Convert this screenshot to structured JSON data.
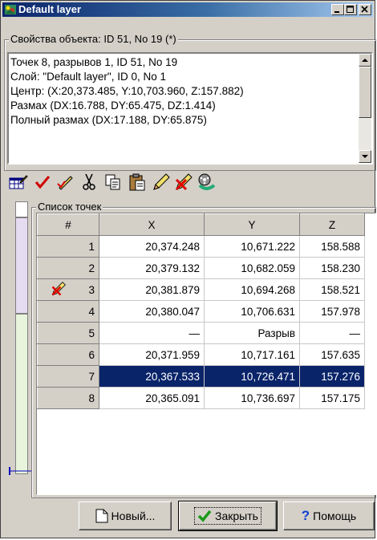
{
  "window": {
    "title": "Default layer",
    "controls": [
      "minimize-icon",
      "maximize-icon",
      "close-icon"
    ]
  },
  "properties": {
    "legend": "Свойства объекта: ID 51, No 19 (*)",
    "lines": [
      "Точек 8, разрывов 1, ID 51, No 19",
      "Слой: \"Default layer\", ID 0, No 1",
      "Центр: (X:20,373.485, Y:10,703.960, Z:157.882)",
      "Размах (DX:16.788, DY:65.475, DZ:1.414)",
      "Полный размах (DX:17.188, DY:65.875)"
    ]
  },
  "toolbar": {
    "icons": [
      "edit-table-icon",
      "check-icon",
      "pencil-check-icon",
      "cut-icon",
      "copy-icon",
      "paste-icon",
      "pencil-icon",
      "pencil-delete-icon",
      "film-reel-icon"
    ]
  },
  "points": {
    "legend": "Список точек",
    "columns": [
      "#",
      "X",
      "Y",
      "Z"
    ],
    "rows": [
      {
        "n": "1",
        "x": "20,374.248",
        "y": "10,671.222",
        "z": "158.588"
      },
      {
        "n": "2",
        "x": "20,379.132",
        "y": "10,682.059",
        "z": "158.230"
      },
      {
        "n": "3",
        "x": "20,381.879",
        "y": "10,694.268",
        "z": "158.521"
      },
      {
        "n": "4",
        "x": "20,380.047",
        "y": "10,706.631",
        "z": "157.978"
      },
      {
        "n": "5",
        "x": "—",
        "y": "Разрыв",
        "z": "—"
      },
      {
        "n": "6",
        "x": "20,371.959",
        "y": "10,717.161",
        "z": "157.635"
      },
      {
        "n": "7",
        "x": "20,367.533",
        "y": "10,726.471",
        "z": "157.276"
      },
      {
        "n": "8",
        "x": "20,365.091",
        "y": "10,736.697",
        "z": "157.175"
      }
    ],
    "selected_row": "7",
    "marked_row": "3"
  },
  "buttons": {
    "new_label": "Новый...",
    "close_label": "Закрыть",
    "help_label": "Помощь"
  },
  "colors": {
    "selection": "#0a246a",
    "titlebar": "#0a246a",
    "face": "#d4d0c8"
  }
}
